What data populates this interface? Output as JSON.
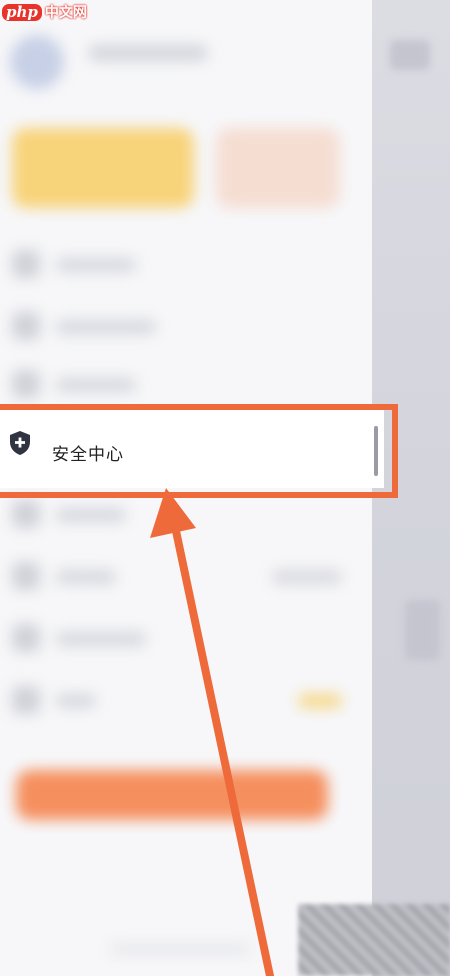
{
  "logo": {
    "php": "php",
    "cn": "中文网"
  },
  "menu": {
    "security_center": {
      "label": "安全中心",
      "icon": "shield-plus-icon"
    }
  },
  "colors": {
    "highlight": "#ee6a3a",
    "card_yellow": "#f7d37a",
    "action_orange": "#f58f5e",
    "drawer_bg": "#f7f7f9"
  }
}
